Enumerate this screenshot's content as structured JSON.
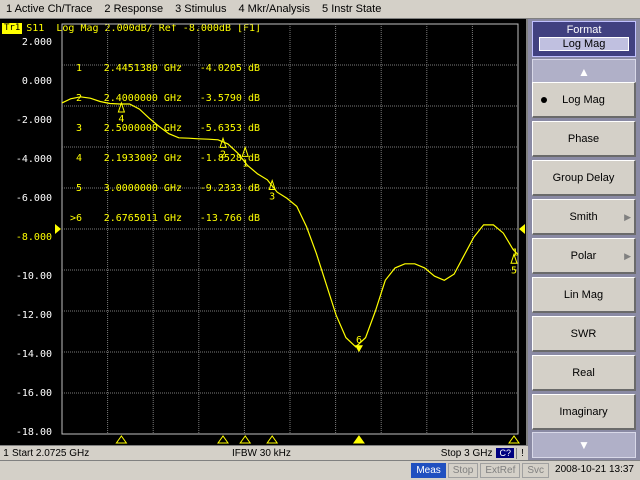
{
  "menu": {
    "items": [
      "1 Active Ch/Trace",
      "2 Response",
      "3 Stimulus",
      "4 Mkr/Analysis",
      "5 Instr State"
    ]
  },
  "trace": {
    "tag": "Tr1",
    "header": "S11  Log Mag 2.000dB/ Ref -8.000dB [F1]",
    "color": "#ffff00"
  },
  "y_axis": {
    "labels": [
      "2.000",
      "0.000",
      "-2.000",
      "-4.000",
      "-6.000",
      "-8.000",
      "-10.00",
      "-12.00",
      "-14.00",
      "-16.00",
      "-18.00"
    ]
  },
  "markers": {
    "rows": [
      [
        "1",
        "2.4451380 GHz",
        "-4.0205 dB"
      ],
      [
        "2",
        "2.4000000 GHz",
        "-3.5790 dB"
      ],
      [
        "3",
        "2.5000000 GHz",
        "-5.6353 dB"
      ],
      [
        "4",
        "2.1933002 GHz",
        "-1.8528 dB"
      ],
      [
        "5",
        "3.0000000 GHz",
        "-9.2333 dB"
      ],
      [
        ">6",
        "2.6765011 GHz",
        "-13.766 dB"
      ]
    ],
    "labels": [
      "4",
      "2",
      "1",
      "3",
      "6",
      "1",
      "5"
    ]
  },
  "plot_status": {
    "channel": "1",
    "start": "Start 2.0725 GHz",
    "ifbw": "IFBW 30 kHz",
    "stop": "Stop 3 GHz",
    "cal": "C?",
    "flag": "!"
  },
  "softkeys": {
    "title": "Format",
    "subtitle": "Log Mag",
    "up_arrow": "▲",
    "down_arrow": "▼",
    "items": [
      "Log Mag",
      "Phase",
      "Group Delay",
      "Smith",
      "Polar",
      "Lin Mag",
      "SWR",
      "Real",
      "Imaginary"
    ]
  },
  "statusbar": {
    "meas": "Meas",
    "stop": "Stop",
    "extref": "ExtRef",
    "svc": "Svc",
    "clock": "2008-10-21 13:37"
  },
  "chart_data": {
    "type": "line",
    "title": "S11  Log Mag 2.000dB/ Ref -8.000dB [F1]",
    "xlabel": "",
    "ylabel": "",
    "xlim": [
      2.0725,
      3.0
    ],
    "ylim": [
      -18,
      2
    ],
    "reference_level": -8.0,
    "grid": true,
    "series": [
      {
        "x": [
          2.0725,
          2.09,
          2.11,
          2.13,
          2.15,
          2.17,
          2.19,
          2.21,
          2.23,
          2.25,
          2.27,
          2.29,
          2.31,
          2.33,
          2.35,
          2.37,
          2.39,
          2.41,
          2.43,
          2.45,
          2.47,
          2.49,
          2.51,
          2.53,
          2.55,
          2.57,
          2.59,
          2.61,
          2.63,
          2.65,
          2.67,
          2.69,
          2.71,
          2.73,
          2.75,
          2.77,
          2.79,
          2.81,
          2.83,
          2.85,
          2.87,
          2.89,
          2.91,
          2.93,
          2.95,
          2.97,
          2.99,
          3.0
        ],
        "y": [
          -1.85,
          -1.65,
          -1.55,
          -1.62,
          -1.78,
          -1.88,
          -1.9,
          -1.9,
          -2.15,
          -2.6,
          -3.0,
          -3.35,
          -3.55,
          -3.57,
          -3.6,
          -3.62,
          -3.65,
          -3.85,
          -4.3,
          -4.9,
          -5.3,
          -5.6,
          -6.2,
          -6.5,
          -6.9,
          -7.9,
          -9.2,
          -10.7,
          -12.2,
          -13.3,
          -13.75,
          -13.3,
          -12.0,
          -10.5,
          -9.9,
          -9.7,
          -9.7,
          -9.9,
          -10.3,
          -10.5,
          -10.2,
          -9.3,
          -8.4,
          -7.8,
          -7.8,
          -8.2,
          -9.0,
          -9.25
        ]
      }
    ]
  }
}
